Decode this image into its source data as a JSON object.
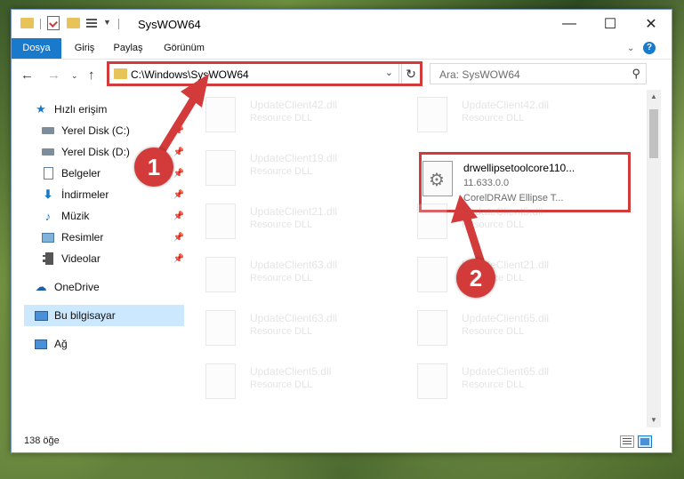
{
  "titlebar": {
    "title": "SysWOW64",
    "minimize_glyph": "—",
    "maximize_glyph": "☐",
    "close_glyph": "✕"
  },
  "ribbon": {
    "tabs": [
      {
        "label": "Dosya",
        "active": true
      },
      {
        "label": "Giriş",
        "active": false
      },
      {
        "label": "Paylaş",
        "active": false
      },
      {
        "label": "Görünüm",
        "active": false
      }
    ],
    "help_glyph": "?"
  },
  "navbar": {
    "address": "C:\\Windows\\SysWOW64",
    "search_placeholder": "Ara: SysWOW64"
  },
  "sidebar": {
    "items": [
      {
        "label": "Hızlı erişim",
        "icon": "star-icon",
        "pinned": false,
        "selected": false
      },
      {
        "label": "Yerel Disk (C:)",
        "icon": "drive-icon",
        "pinned": true,
        "selected": false
      },
      {
        "label": "Yerel Disk (D:)",
        "icon": "drive-icon",
        "pinned": true,
        "selected": false
      },
      {
        "label": "Belgeler",
        "icon": "documents-icon",
        "pinned": true,
        "selected": false
      },
      {
        "label": "İndirmeler",
        "icon": "downloads-icon",
        "pinned": true,
        "selected": false
      },
      {
        "label": "Müzik",
        "icon": "music-icon",
        "pinned": true,
        "selected": false
      },
      {
        "label": "Resimler",
        "icon": "pictures-icon",
        "pinned": true,
        "selected": false
      },
      {
        "label": "Videolar",
        "icon": "videos-icon",
        "pinned": true,
        "selected": false
      },
      {
        "label": "OneDrive",
        "icon": "cloud-icon",
        "pinned": false,
        "selected": false
      },
      {
        "label": "Bu bilgisayar",
        "icon": "computer-icon",
        "pinned": false,
        "selected": true
      },
      {
        "label": "Ağ",
        "icon": "network-icon",
        "pinned": false,
        "selected": false
      }
    ]
  },
  "files": {
    "left": [
      {
        "name": "UpdateClient42.dll",
        "desc": "Resource DLL"
      },
      {
        "name": "UpdateClient19.dll",
        "desc": "Resource DLL"
      },
      {
        "name": "UpdateClient21.dll",
        "desc": "Resource DLL"
      },
      {
        "name": "UpdateClient63.dll",
        "desc": "Resource DLL"
      },
      {
        "name": "UpdateClient63.dll",
        "desc": "Resource DLL"
      },
      {
        "name": "UpdateClient5.dll",
        "desc": "Resource DLL"
      }
    ],
    "right": [
      {
        "name": "UpdateClient42.dll",
        "desc": "Resource DLL"
      },
      {
        "name": "UpdateClient5.dll",
        "desc": "Resource DLL"
      },
      {
        "name": "UpdateClient21.dll",
        "desc": "Resource DLL"
      },
      {
        "name": "UpdateClient65.dll",
        "desc": "Resource DLL"
      },
      {
        "name": "UpdateClient65.dll",
        "desc": "Resource DLL"
      }
    ],
    "highlighted": {
      "name": "drwellipsetoolcore110...",
      "version": "11.633.0.0",
      "desc": "CorelDRAW Ellipse T..."
    }
  },
  "statusbar": {
    "item_count": "138 öğe"
  },
  "annotations": {
    "step1": "1",
    "step2": "2",
    "color": "#d33a3a"
  }
}
